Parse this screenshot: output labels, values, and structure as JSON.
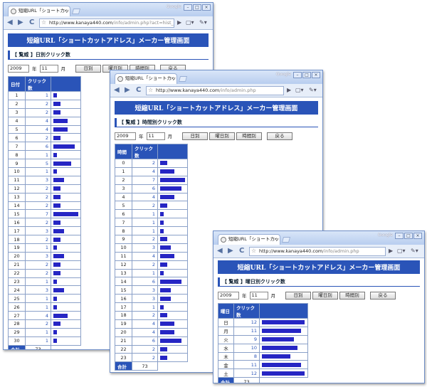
{
  "browser": {
    "tab_title": "短縮URL「ショートカットアドレ",
    "tab_close": "×",
    "brand": "Google",
    "win_buttons": [
      "–",
      "□",
      "×"
    ],
    "back": "◀",
    "forward": "▶",
    "reload": "C",
    "page_menu": "▢▾",
    "tools_menu": "✎▾"
  },
  "common": {
    "banner": "短縮URL「ショートカットアドレス」メーカー管理画面",
    "year": "2009",
    "year_label": "年",
    "month": "11",
    "month_label": "月",
    "btn_day": "日別",
    "btn_weekday": "曜日別",
    "btn_hour": "時間別",
    "btn_back": "戻る",
    "col_count": "クリック数",
    "total_label": "合計",
    "total": "73"
  },
  "win1": {
    "url_host": "http://www.kanaya440.com",
    "url_path": "/info/admin.php?act=hist_day&",
    "subtitle": "【 覧威 】日別クリック数",
    "col_key": "日付",
    "rows": [
      {
        "k": "1",
        "v": 1
      },
      {
        "k": "2",
        "v": 2
      },
      {
        "k": "3",
        "v": 2
      },
      {
        "k": "4",
        "v": 4
      },
      {
        "k": "5",
        "v": 4
      },
      {
        "k": "6",
        "v": 2
      },
      {
        "k": "7",
        "v": 6
      },
      {
        "k": "8",
        "v": 1
      },
      {
        "k": "9",
        "v": 5
      },
      {
        "k": "10",
        "v": 1
      },
      {
        "k": "11",
        "v": 3
      },
      {
        "k": "12",
        "v": 2
      },
      {
        "k": "13",
        "v": 2
      },
      {
        "k": "14",
        "v": 2
      },
      {
        "k": "15",
        "v": 7
      },
      {
        "k": "16",
        "v": 2
      },
      {
        "k": "17",
        "v": 3
      },
      {
        "k": "18",
        "v": 2
      },
      {
        "k": "19",
        "v": 1
      },
      {
        "k": "20",
        "v": 3
      },
      {
        "k": "21",
        "v": 2
      },
      {
        "k": "22",
        "v": 2
      },
      {
        "k": "23",
        "v": 1
      },
      {
        "k": "24",
        "v": 3
      },
      {
        "k": "25",
        "v": 1
      },
      {
        "k": "26",
        "v": 1
      },
      {
        "k": "27",
        "v": 4
      },
      {
        "k": "28",
        "v": 2
      },
      {
        "k": "29",
        "v": 1
      },
      {
        "k": "30",
        "v": 1
      }
    ]
  },
  "win2": {
    "url_host": "http://www.kanaya440.com",
    "url_path": "/info/admin.php",
    "subtitle": "【 覧威 】時間別クリック数",
    "col_key": "時間",
    "rows": [
      {
        "k": "0",
        "v": 2
      },
      {
        "k": "1",
        "v": 4
      },
      {
        "k": "2",
        "v": 7
      },
      {
        "k": "3",
        "v": 6
      },
      {
        "k": "4",
        "v": 4
      },
      {
        "k": "5",
        "v": 2
      },
      {
        "k": "6",
        "v": 1
      },
      {
        "k": "7",
        "v": 1
      },
      {
        "k": "8",
        "v": 1
      },
      {
        "k": "9",
        "v": 2
      },
      {
        "k": "10",
        "v": 3
      },
      {
        "k": "11",
        "v": 4
      },
      {
        "k": "12",
        "v": 2
      },
      {
        "k": "13",
        "v": 1
      },
      {
        "k": "14",
        "v": 6
      },
      {
        "k": "15",
        "v": 3
      },
      {
        "k": "16",
        "v": 3
      },
      {
        "k": "17",
        "v": 1
      },
      {
        "k": "18",
        "v": 2
      },
      {
        "k": "19",
        "v": 4
      },
      {
        "k": "20",
        "v": 4
      },
      {
        "k": "21",
        "v": 6
      },
      {
        "k": "22",
        "v": 2
      },
      {
        "k": "23",
        "v": 2
      }
    ]
  },
  "win3": {
    "url_host": "http://www.kanaya440.com",
    "url_path": "/info/admin.php",
    "subtitle": "【 覧威 】曜日別クリック数",
    "col_key": "曜日",
    "rows": [
      {
        "k": "日",
        "v": 12
      },
      {
        "k": "月",
        "v": 11
      },
      {
        "k": "火",
        "v": 9
      },
      {
        "k": "水",
        "v": 10
      },
      {
        "k": "木",
        "v": 8
      },
      {
        "k": "金",
        "v": 11
      },
      {
        "k": "土",
        "v": 12
      }
    ]
  }
}
